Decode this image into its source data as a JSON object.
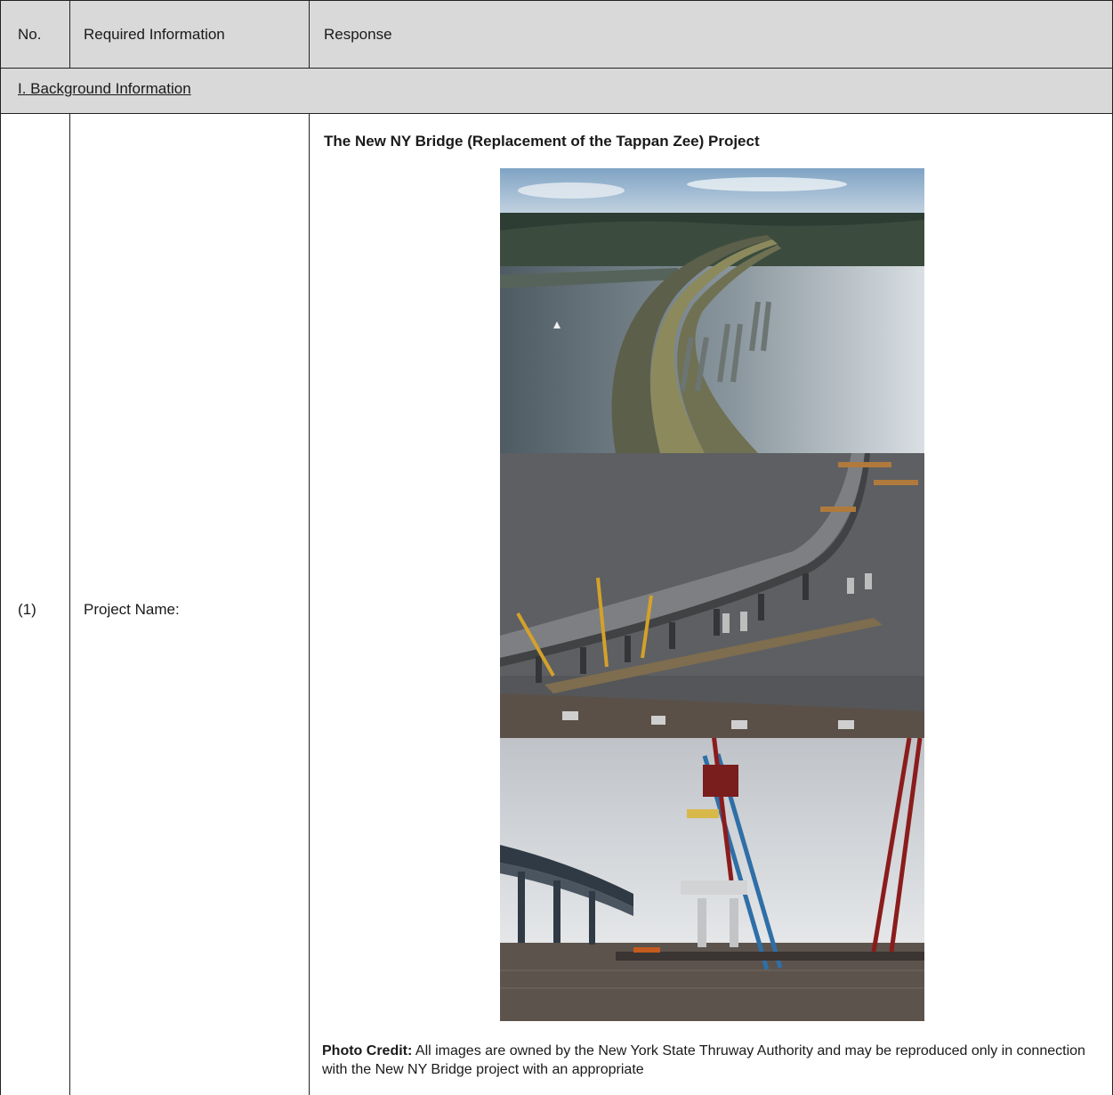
{
  "header": {
    "col_no": "No.",
    "col_required": "Required Information",
    "col_response": "Response"
  },
  "section": {
    "title": "I. Background Information"
  },
  "row1": {
    "number": "(1)",
    "label": "Project Name:",
    "project_title": "The New NY Bridge (Replacement of the Tappan Zee) Project",
    "photo_credit_label": "Photo Credit:",
    "photo_credit_text": " All images are owned by the New York State Thruway Authority and may be reproduced only in connection with the New NY Bridge project with an appropriate"
  },
  "photos": [
    {
      "name": "aerial-bridge-rendering"
    },
    {
      "name": "bridge-construction-aerial"
    },
    {
      "name": "crane-lifting-girder"
    }
  ],
  "colors": {
    "header_bg": "#d9d9d9",
    "border": "#222222"
  }
}
